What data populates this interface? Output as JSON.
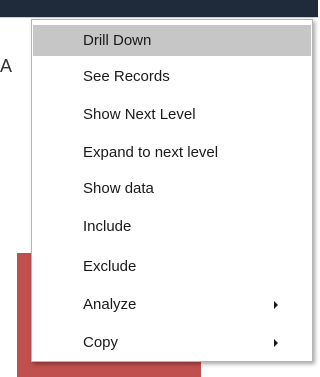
{
  "background": {
    "fragment_text": "A",
    "topbar_color": "#1f2a3a",
    "red_color": "#c0504d"
  },
  "menu": {
    "highlight_color": "#c6c6c6",
    "items": [
      {
        "label": "Drill Down",
        "highlighted": true,
        "submenu": false
      },
      {
        "label": "See Records",
        "highlighted": false,
        "submenu": false
      },
      {
        "label": "Show Next Level",
        "highlighted": false,
        "submenu": false
      },
      {
        "label": "Expand to next level",
        "highlighted": false,
        "submenu": false
      },
      {
        "label": "Show data",
        "highlighted": false,
        "submenu": false
      },
      {
        "label": "Include",
        "highlighted": false,
        "submenu": false
      },
      {
        "label": "Exclude",
        "highlighted": false,
        "submenu": false
      },
      {
        "label": "Analyze",
        "highlighted": false,
        "submenu": true
      },
      {
        "label": "Copy",
        "highlighted": false,
        "submenu": true
      }
    ]
  }
}
